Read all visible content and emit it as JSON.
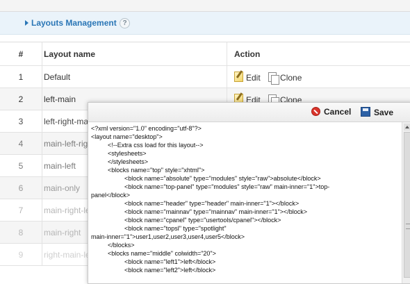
{
  "section": {
    "title": "Layouts Management",
    "help": "?"
  },
  "table": {
    "headers": [
      "#",
      "Layout name",
      "Action"
    ],
    "rows": [
      {
        "num": "1",
        "name": "Default",
        "edit": "Edit",
        "clone": "Clone"
      },
      {
        "num": "2",
        "name": "left-main",
        "edit": "Edit",
        "clone": "Clone"
      },
      {
        "num": "3",
        "name": "left-right-ma"
      },
      {
        "num": "4",
        "name": "main-left-rig"
      },
      {
        "num": "5",
        "name": "main-left"
      },
      {
        "num": "6",
        "name": "main-only"
      },
      {
        "num": "7",
        "name": "main-right-le"
      },
      {
        "num": "8",
        "name": "main-right"
      },
      {
        "num": "9",
        "name": "right-main-le"
      }
    ]
  },
  "editor": {
    "cancel_label": "Cancel",
    "save_label": "Save",
    "code_lines": [
      {
        "indent": 0,
        "text": "<?xml version=\"1.0\" encoding=\"utf-8\"?>"
      },
      {
        "indent": 0,
        "text": "<layout name=\"desktop\">"
      },
      {
        "indent": 1,
        "text": "<!--Extra css load for this layout-->"
      },
      {
        "indent": 1,
        "text": "<stylesheets>"
      },
      {
        "indent": 1,
        "text": "</stylesheets>"
      },
      {
        "indent": 1,
        "text": "<blocks name=\"top\" style=\"xhtml\">"
      },
      {
        "indent": 2,
        "text": "<block name=\"absolute\" type=\"modules\" style=\"raw\">absolute</block>"
      },
      {
        "indent": 2,
        "text": "<block name=\"top-panel\" type=\"modules\" style=\"raw\" main-inner=\"1\">top-"
      },
      {
        "indent": 0,
        "text": "panel</block>"
      },
      {
        "indent": 2,
        "text": "<block name=\"header\" type=\"header\" main-inner=\"1\"></block>"
      },
      {
        "indent": 2,
        "text": "<block name=\"mainnav\" type=\"mainnav\" main-inner=\"1\"></block>"
      },
      {
        "indent": 2,
        "text": "<block name=\"cpanel\" type=\"usertools/cpanel\"></block>"
      },
      {
        "indent": 2,
        "text": "<block name=\"topsl\" type=\"spotlight\""
      },
      {
        "indent": 0,
        "text": "main-inner=\"1\">user1,user2,user3,user4,user5</block>"
      },
      {
        "indent": 1,
        "text": "</blocks>"
      },
      {
        "indent": 1,
        "text": "<blocks name=\"middle\" colwidth=\"20\">"
      },
      {
        "indent": 2,
        "text": "<block name=\"left1\">left</block>"
      },
      {
        "indent": 2,
        "text": "<block name=\"left2\">left</block>"
      }
    ]
  }
}
